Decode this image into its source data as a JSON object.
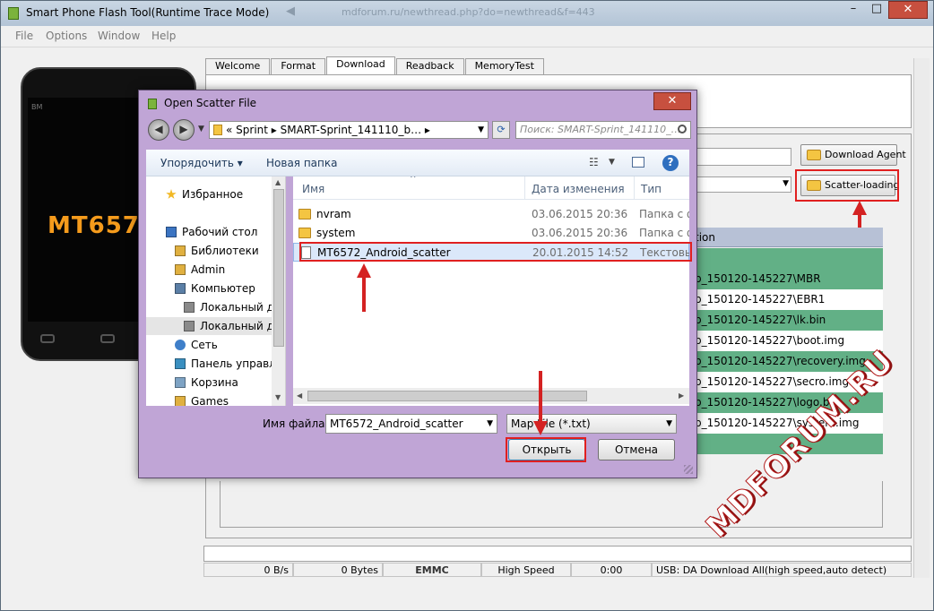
{
  "window": {
    "title": "Smart Phone Flash Tool(Runtime Trace Mode)",
    "ghost_url": "mdforum.ru/newthread.php?do=newthread&f=443",
    "controls": {
      "minimize": "–",
      "maximize": "□",
      "close": "✕"
    }
  },
  "menu": [
    {
      "label": "File"
    },
    {
      "label": "Options"
    },
    {
      "label": "Window"
    },
    {
      "label": "Help"
    }
  ],
  "phone": {
    "brand": "BM",
    "model": "MT657"
  },
  "tabs": [
    {
      "label": "Welcome"
    },
    {
      "label": "Format"
    },
    {
      "label": "Download"
    },
    {
      "label": "Readback"
    },
    {
      "label": "MemoryTest"
    }
  ],
  "buttons": {
    "download_agent": "Download Agent",
    "scatter_loading": "Scatter-loading"
  },
  "partition_table": {
    "header": "tion",
    "rows": [
      {
        "text": "",
        "highlighted": true
      },
      {
        "text": "p_150120-145227\\MBR",
        "highlighted": true
      },
      {
        "text": "p_150120-145227\\EBR1",
        "highlighted": false
      },
      {
        "text": "p_150120-145227\\lk.bin",
        "highlighted": true
      },
      {
        "text": "p_150120-145227\\boot.img",
        "highlighted": false
      },
      {
        "text": "p_150120-145227\\recovery.img",
        "highlighted": true
      },
      {
        "text": "p_150120-145227\\secro.img",
        "highlighted": false
      },
      {
        "text": "p_150120-145227\\logo.bin",
        "highlighted": true
      },
      {
        "text": "p_150120-145227\\system.img",
        "highlighted": false
      },
      {
        "text": "",
        "highlighted": true
      }
    ]
  },
  "statusbar": {
    "speed": "0 B/s",
    "bytes": "0 Bytes",
    "storage": "EMMC",
    "mode": "High Speed",
    "time": "0:00",
    "message": "USB: DA Download All(high speed,auto detect)"
  },
  "watermark": "MDFORUM.RU",
  "dialog": {
    "title": "Open Scatter File",
    "close": "✕",
    "breadcrumb": "«  Sprint  ▸  SMART-Sprint_141110_b…  ▸",
    "search_placeholder": "Поиск: SMART-Sprint_141110_…",
    "toolbar": {
      "organize": "Упорядочить ▾",
      "new_folder": "Новая папка"
    },
    "nav_items": [
      {
        "label": "Избранное",
        "icon": "star-icon",
        "color": "#f2b824"
      },
      {
        "label": "Рабочий стол",
        "icon": "desktop-icon",
        "color": "#3b74c2"
      },
      {
        "label": "Библиотеки",
        "icon": "library-icon",
        "color": "#e0b040"
      },
      {
        "label": "Admin",
        "icon": "user-folder-icon",
        "color": "#e0b040"
      },
      {
        "label": "Компьютер",
        "icon": "computer-icon",
        "color": "#5b7fa6"
      },
      {
        "label": "Локальный ди",
        "icon": "drive-icon",
        "color": "#8a8a8a"
      },
      {
        "label": "Локальный ди",
        "icon": "drive-icon",
        "color": "#8a8a8a"
      },
      {
        "label": "Сеть",
        "icon": "network-icon",
        "color": "#3f7fc9"
      },
      {
        "label": "Панель управле",
        "icon": "control-panel-icon",
        "color": "#3a8fc0"
      },
      {
        "label": "Корзина",
        "icon": "recycle-bin-icon",
        "color": "#7ea3c4"
      },
      {
        "label": "Games",
        "icon": "games-folder-icon",
        "color": "#e0b040"
      }
    ],
    "columns": {
      "name": "Имя",
      "date": "Дата изменения",
      "type": "Тип"
    },
    "files": [
      {
        "name": "nvram",
        "date": "03.06.2015 20:36",
        "type": "Папка с ф",
        "kind": "folder",
        "selected": false
      },
      {
        "name": "system",
        "date": "03.06.2015 20:36",
        "type": "Папка с ф",
        "kind": "folder",
        "selected": false
      },
      {
        "name": "MT6572_Android_scatter",
        "date": "20.01.2015 14:52",
        "type": "Текстовы",
        "kind": "document",
        "selected": true
      }
    ],
    "filename_label": "Имя файла:",
    "filename_value": "MT6572_Android_scatter",
    "filetype_value": "Map File (*.txt)",
    "open_label": "Открыть",
    "cancel_label": "Отмена"
  }
}
